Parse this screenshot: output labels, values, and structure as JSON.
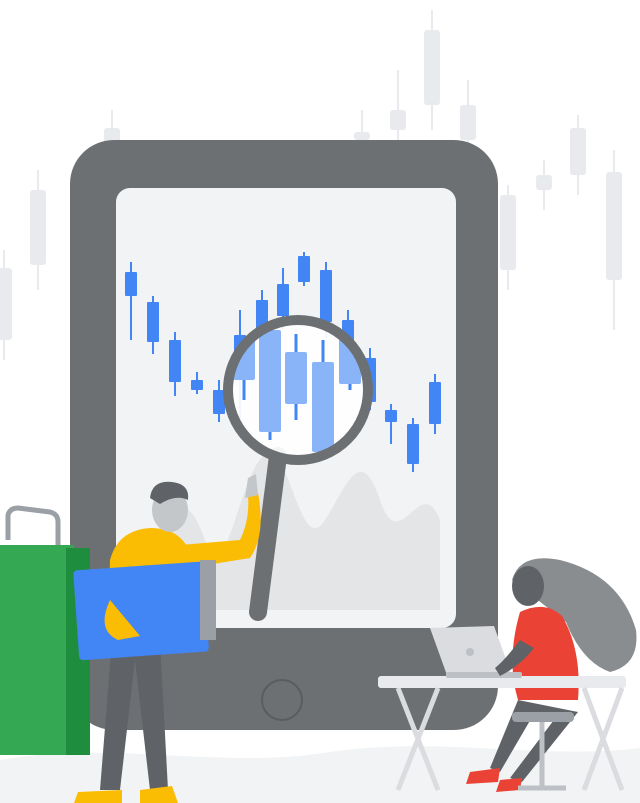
{
  "colors": {
    "background": "#ffffff",
    "bg_candles": "#e8eaed",
    "tablet_frame": "#6d7072",
    "tablet_screen": "#f1f3f4",
    "candle_blue": "#4285f4",
    "magnifier_lens": "#8ab4f8",
    "magnifier_ring": "#6d7072",
    "bag_green": "#34a853",
    "bag_dark_green": "#1e8e3e",
    "shirt_yellow": "#fbbc04",
    "folder_blue": "#4285f4",
    "shirt_red": "#ea4335",
    "hair_gray": "#8a8d90",
    "skin": "#c4c7c9",
    "pants": "#5f6368",
    "shoe_red": "#ea4335",
    "shoe_yellow": "#fbbc04",
    "desk": "#e8eaed",
    "laptop": "#dadce0"
  },
  "icons": [
    "candlestick-chart-icon",
    "magnifying-glass-icon",
    "shopping-bag-icon",
    "laptop-icon"
  ]
}
